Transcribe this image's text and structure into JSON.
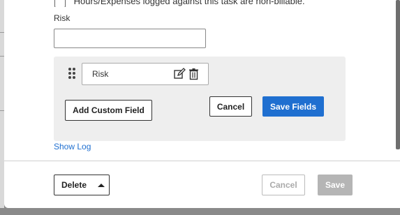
{
  "top_cut_row": {
    "checkbox_checked": false,
    "text": "Hours/Expenses logged against this task are non-billable."
  },
  "risk_field": {
    "label": "Risk",
    "value": "",
    "placeholder": ""
  },
  "custom_fields": {
    "items": [
      {
        "label": "Risk"
      }
    ],
    "add_button_label": "Add Custom Field",
    "cancel_button_label": "Cancel",
    "save_button_label": "Save Fields"
  },
  "show_log_label": "Show Log",
  "footer": {
    "delete_label": "Delete",
    "cancel_label": "Cancel",
    "save_label": "Save"
  },
  "colors": {
    "primary": "#1f6fd0",
    "panel_bg": "#eeeeee",
    "disabled_fill": "#b5b5b5",
    "overlay": "#8a8a8a"
  },
  "icons": {
    "drag": "drag-handle-icon",
    "edit": "edit-icon",
    "delete": "trash-icon",
    "menu": "caret-up-icon"
  }
}
